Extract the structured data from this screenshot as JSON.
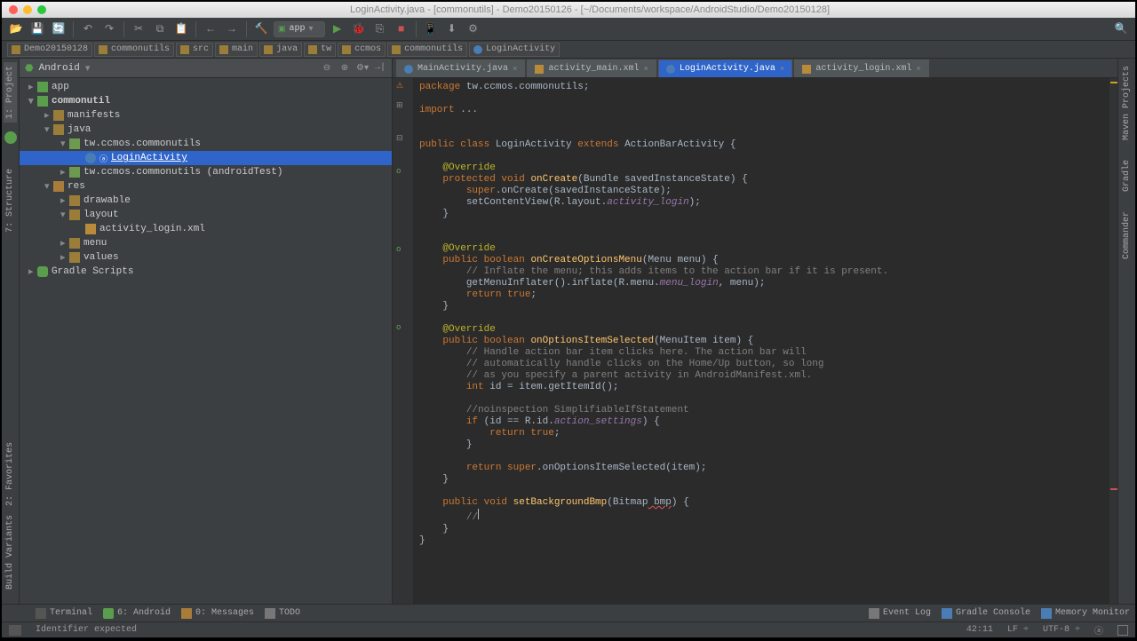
{
  "title": "LoginActivity.java - [commonutils] - Demo20150126 - [~/Documents/workspace/AndroidStudio/Demo20150128]",
  "run_config": "app",
  "breadcrumbs": [
    "Demo20150128",
    "commonutils",
    "src",
    "main",
    "java",
    "tw",
    "ccmos",
    "commonutils",
    "LoginActivity"
  ],
  "proj_dropdown": "Android",
  "tree": {
    "app": "app",
    "module": "commonutil",
    "manifests": "manifests",
    "java": "java",
    "pkg": "tw.ccmos.commonutils",
    "login": "LoginActivity",
    "pkgtest": "tw.ccmos.commonutils (androidTest)",
    "res": "res",
    "drawable": "drawable",
    "layout": "layout",
    "layout_file": "activity_login.xml",
    "menu": "menu",
    "values": "values",
    "gradle": "Gradle Scripts"
  },
  "tabs": {
    "t1": "MainActivity.java",
    "t2": "activity_main.xml",
    "t3": "LoginActivity.java",
    "t4": "activity_login.xml"
  },
  "code": {
    "l1": "package tw.ccmos.commonutils;",
    "l2": "import ...",
    "l3_a": "public class ",
    "l3_b": "LoginActivity ",
    "l3_c": "extends ",
    "l3_d": "ActionBarActivity {",
    "ov": "@Override",
    "oc1": "protected void ",
    "oc2": "onCreate",
    "oc3": "(Bundle savedInstanceState) {",
    "oc4": "super",
    "oc5": ".onCreate(savedInstanceState);",
    "oc6": "setContentView(R.layout.",
    "oc7": "activity_login",
    "oc8": ");",
    "om1": "public boolean ",
    "om2": "onCreateOptionsMenu",
    "om3": "(Menu menu) {",
    "om4": "// Inflate the menu; this adds items to the action bar if it is present.",
    "om5": "getMenuInflater().inflate(R.menu.",
    "om6": "menu_login",
    "om7": ", menu);",
    "om8": "return true",
    "oi1": "public boolean ",
    "oi2": "onOptionsItemSelected",
    "oi3": "(MenuItem item) {",
    "oi4": "// Handle action bar item clicks here. The action bar will",
    "oi5": "// automatically handle clicks on the Home/Up button, so long",
    "oi6": "// as you specify a parent activity in AndroidManifest.xml.",
    "oi7": "int ",
    "oi8": "id = item.getItemId();",
    "oi9": "//noinspection SimplifiableIfStatement",
    "oi10": "if ",
    "oi11": "(id == R.id.",
    "oi12": "action_settings",
    "oi13": ") {",
    "oi14": "return true",
    "oi15": "return super",
    "oi16": ".onOptionsItemSelected(item);",
    "sb1": "public void ",
    "sb2": "setBackgroundBmp",
    "sb3": "(Bitmap",
    "sb4": " bmp",
    "sb5": ") {",
    "sb6": "//"
  },
  "bottom": {
    "terminal": "Terminal",
    "android": "6: Android",
    "messages": "0: Messages",
    "todo": "TODO",
    "eventlog": "Event Log",
    "gradle": "Gradle Console",
    "memmon": "Memory Monitor"
  },
  "status": {
    "msg": "Identifier expected",
    "pos": "42:11",
    "le": "LF",
    "enc": "UTF-8"
  },
  "right_rail": {
    "maven": "Maven Projects",
    "gradle": "Gradle",
    "commander": "Commander"
  },
  "left_rail": {
    "project": "1: Project",
    "structure": "7: Structure",
    "favorites": "2: Favorites",
    "buildvar": "Build Variants"
  }
}
